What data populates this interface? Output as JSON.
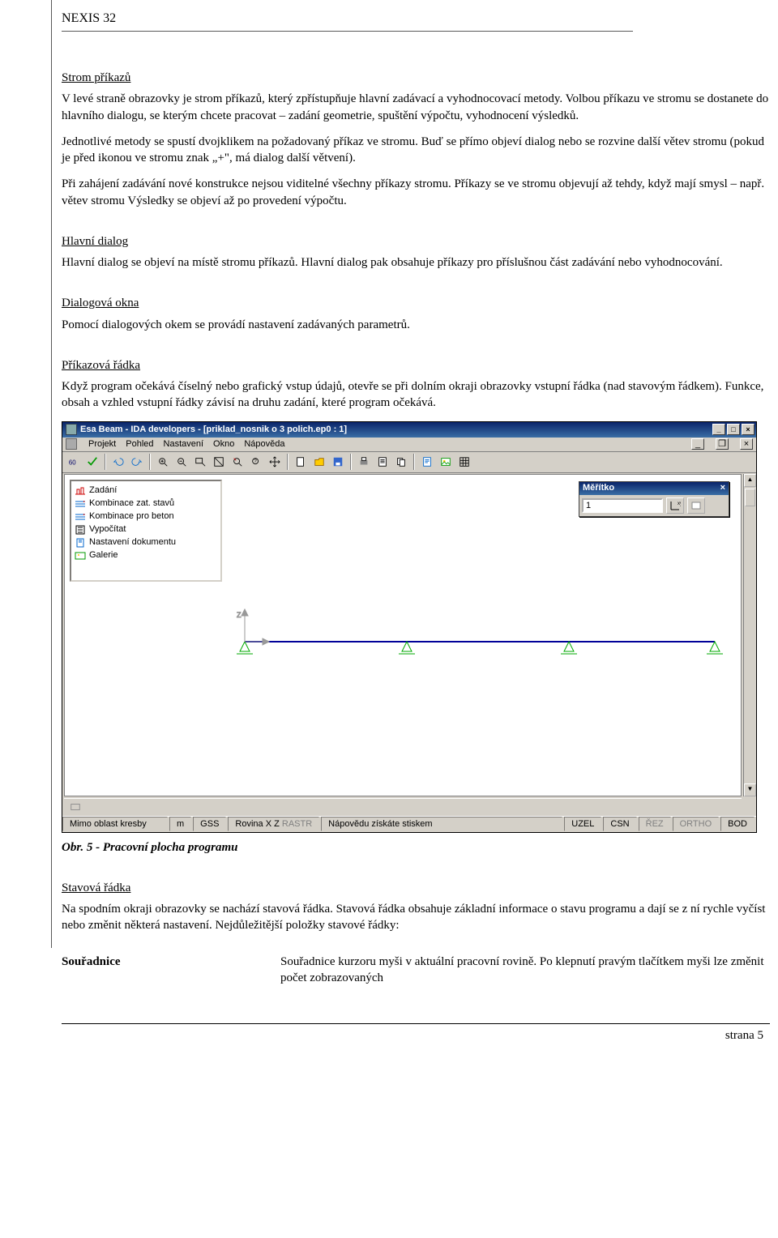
{
  "header": {
    "title": "NEXIS 32"
  },
  "sections": {
    "strom": {
      "title": "Strom příkazů",
      "p1": "V levé straně obrazovky je strom příkazů, který zpřístupňuje hlavní zadávací a vyhodnocovací metody. Volbou příkazu ve stromu se dostanete do hlavního dialogu, se kterým chcete pracovat – zadání geometrie, spuštění výpočtu, vyhodnocení výsledků.",
      "p2": "Jednotlivé metody se spustí dvojklikem na požadovaný příkaz ve stromu. Buď se přímo objeví dialog nebo se rozvine další větev stromu (pokud je před ikonou ve stromu znak „+\", má dialog další větvení).",
      "p3": "Při zahájení zadávání nové konstrukce nejsou viditelné všechny příkazy stromu. Příkazy se ve stromu objevují až tehdy, když mají smysl – např. větev stromu Výsledky se objeví až po provedení výpočtu."
    },
    "hlavni": {
      "title": "Hlavní dialog",
      "p1": "Hlavní dialog se objeví na místě stromu příkazů. Hlavní dialog pak obsahuje příkazy pro příslušnou část zadávání nebo vyhodnocování."
    },
    "dlg": {
      "title": "Dialogová okna",
      "p1": "Pomocí dialogových okem se provádí nastavení zadávaných parametrů."
    },
    "cmd": {
      "title": "Příkazová řádka",
      "p1": "Když program očekává číselný nebo grafický vstup údajů, otevře se při dolním okraji obrazovky vstupní řádka (nad stavovým řádkem). Funkce, obsah a vzhled vstupní řádky závisí na druhu zadání, které program očekává."
    },
    "figcaption": "Obr. 5 - Pracovní plocha programu",
    "stav": {
      "title": "Stavová řádka",
      "p1": "Na spodním okraji obrazovky se nachází stavová řádka. Stavová řádka obsahuje základní informace o stavu programu a dají se z ní rychle vyčíst nebo změnit některá nastavení. Nejdůležitější položky stavové řádky:"
    },
    "sour": {
      "k": "Souřadnice",
      "v": "Souřadnice kurzoru myši v aktuální pracovní rovině. Po klepnutí pravým tlačítkem myši lze změnit počet zobrazovaných"
    }
  },
  "app": {
    "title": "Esa Beam - IDA developers - [priklad_nosnik o 3 polich.ep0 : 1]",
    "menu": {
      "i0": "Projekt",
      "i1": "Pohled",
      "i2": "Nastavení",
      "i3": "Okno",
      "i4": "Nápověda"
    },
    "tree": {
      "i0": "Zadání",
      "i1": "Kombinace zat. stavů",
      "i2": "Kombinace pro beton",
      "i3": "Vypočítat",
      "i4": "Nastavení dokumentu",
      "i5": "Galerie"
    },
    "float": {
      "title": "Měřítko",
      "value": "1",
      "close": "×"
    },
    "status": {
      "s0": "Mimo oblast kresby",
      "s1": "m",
      "s2": "GSS",
      "s3": "Rovina X Z",
      "s3b": "RASTR",
      "s4": "Nápovědu získáte stiskem",
      "s5": "UZEL",
      "s6": "CSN",
      "s7": "ŘEZ",
      "s8": "ORTHO",
      "s9": "BOD"
    },
    "winbtns": {
      "min": "_",
      "max": "□",
      "close": "×",
      "mdimin": "_",
      "mdimax": "❐",
      "mdiclose": "×"
    }
  },
  "footer": {
    "page": "strana 5"
  }
}
